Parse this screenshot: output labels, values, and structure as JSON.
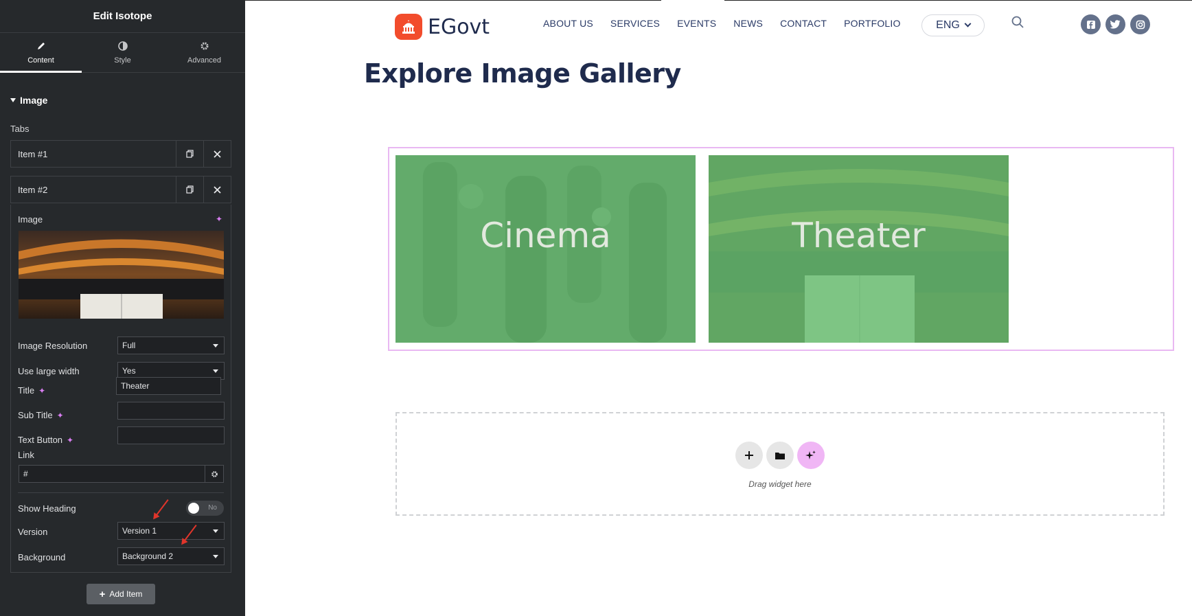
{
  "panel": {
    "title": "Edit Isotope",
    "tabs": [
      {
        "label": "Content",
        "icon": "pencil-icon"
      },
      {
        "label": "Style",
        "icon": "half-circle-icon"
      },
      {
        "label": "Advanced",
        "icon": "gear-icon"
      }
    ],
    "section_title": "Image",
    "tabs_label": "Tabs",
    "items": [
      {
        "label": "Item #1"
      },
      {
        "label": "Item #2"
      }
    ],
    "fields": {
      "image_label": "Image",
      "image_resolution_label": "Image Resolution",
      "image_resolution_value": "Full",
      "use_large_width_label": "Use large width",
      "use_large_width_value": "Yes",
      "title_label": "Title",
      "title_value": "Theater",
      "subtitle_label": "Sub Title",
      "subtitle_value": "",
      "text_button_label": "Text Button",
      "text_button_value": "",
      "link_label": "Link",
      "link_value": "#",
      "show_heading_label": "Show Heading",
      "show_heading_value": "No",
      "version_label": "Version",
      "version_value": "Version 1",
      "background_label": "Background",
      "background_value": "Background 2"
    },
    "add_item_label": "Add Item"
  },
  "site": {
    "logo_text": "EGovt",
    "nav": [
      "ABOUT US",
      "SERVICES",
      "EVENTS",
      "NEWS",
      "CONTACT",
      "PORTFOLIO"
    ],
    "lang": "ENG",
    "page_title": "Explore Image Gallery",
    "gallery": [
      {
        "title": "Cinema"
      },
      {
        "title": "Theater"
      }
    ],
    "dropzone_text": "Drag widget here"
  },
  "colors": {
    "panel_bg": "#26292c",
    "accent_pink": "#e9b8f2",
    "overlay_green": "#67be70",
    "brand_red": "#f24c2c",
    "navy": "#1f2b4d"
  }
}
